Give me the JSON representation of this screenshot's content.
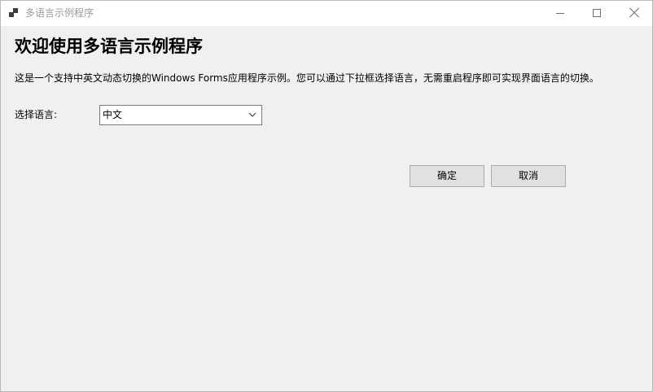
{
  "window": {
    "title": "多语言示例程序",
    "icon": "app-window-icon",
    "controls": [
      "minimize-icon",
      "maximize-icon",
      "close-icon"
    ]
  },
  "main": {
    "heading": "欢迎使用多语言示例程序",
    "description": "这是一个支持中英文动态切换的Windows Forms应用程序示例。您可以通过下拉框选择语言，无需重启程序即可实现界面语言的切换。",
    "language_label": "选择语言:",
    "language_select": {
      "value": "中文"
    },
    "ok_label": "确定",
    "cancel_label": "取消"
  },
  "colors": {
    "background": "#f0f0f0",
    "titlebar": "#ffffff",
    "button_face": "#e1e1e1",
    "button_border": "#adadad"
  }
}
